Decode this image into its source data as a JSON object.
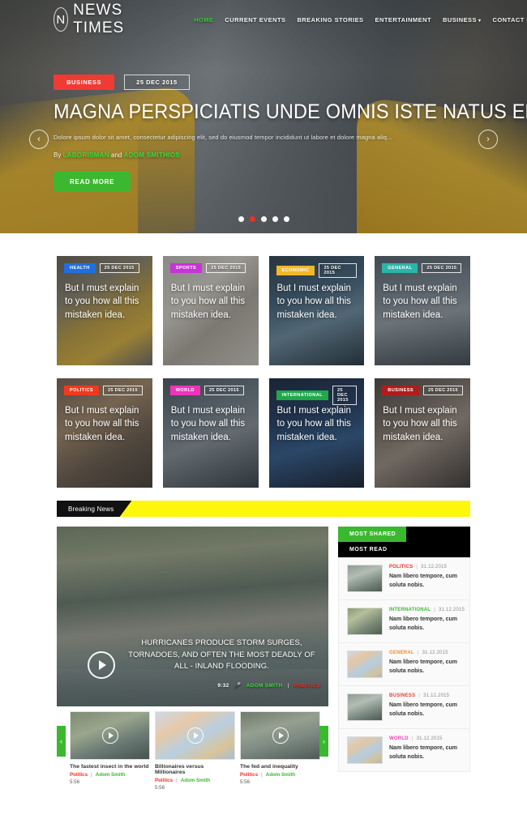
{
  "header": {
    "logo_initial": "N",
    "logo_text": "NEWS TIMES",
    "nav": [
      {
        "label": "HOME",
        "active": true
      },
      {
        "label": "CURRENT EVENTS",
        "active": false
      },
      {
        "label": "BREAKING STORIES",
        "active": false
      },
      {
        "label": "ENTERTAINMENT",
        "active": false
      },
      {
        "label": "BUSINESS",
        "active": false,
        "caret": "▾"
      },
      {
        "label": "CONTACT US",
        "active": false
      }
    ]
  },
  "hero": {
    "category": "BUSINESS",
    "category_color": "#ef3b33",
    "date": "25 DEC 2015",
    "title": "MAGNA PERSPICIATIS UNDE OMNIS ISTE NATUS ERRORS",
    "description": "Dolore ipsum dolor sit amet, consectetur adipiscing elit, sed do eiusmod tempor incididunt ut labore et dolore magna aliq...",
    "by_prefix": "By",
    "author1": "LABORISMAN",
    "by_and": "and",
    "author2": "ADOM SMITHIOS",
    "read_more": "READ MORE",
    "prev_arrow": "‹",
    "next_arrow": "›",
    "dots": 5,
    "active_dot": 1,
    "dot_active_color": "#ee3124"
  },
  "cards": [
    {
      "category": "HEALTH",
      "color": "#1f6fe0",
      "date": "25 DEC 2015",
      "title": "But I must explain to you how all this mistaken idea.",
      "photo": "ph-taxi"
    },
    {
      "category": "SPORTS",
      "color": "#c634d6",
      "date": "25 DEC 2015",
      "title": "But I must explain to you how all this mistaken idea.",
      "photo": "ph-paper"
    },
    {
      "category": "ECONOMIC",
      "color": "#f2b827",
      "date": "25 DEC 2015",
      "title": "But I must explain to you how all this mistaken idea.",
      "photo": "ph-plane"
    },
    {
      "category": "GENERAL",
      "color": "#2bb5a8",
      "date": "25 DEC 2015",
      "title": "But I must explain to you how all this mistaken idea.",
      "photo": "ph-tower"
    },
    {
      "category": "POLITICS",
      "color": "#f03a1e",
      "date": "25 DEC 2015",
      "title": "But I must explain to you how all this mistaken idea.",
      "photo": "ph-hands"
    },
    {
      "category": "WORLD",
      "color": "#ee33bb",
      "date": "25 DEC 2015",
      "title": "But I must explain to you how all this mistaken idea.",
      "photo": "ph-city"
    },
    {
      "category": "INTERNATIONAL",
      "color": "#1fa94a",
      "date": "25 DEC 2015",
      "title": "But I must explain to you how all this mistaken idea.",
      "photo": "ph-night"
    },
    {
      "category": "BUSINESS",
      "color": "#b01c1c",
      "date": "25 DEC 2015",
      "title": "But I must explain to you how all this mistaken idea.",
      "photo": "ph-wood"
    }
  ],
  "breaking": {
    "label": "Breaking News",
    "bar_color": "#fdf70c"
  },
  "video": {
    "caption": "HURRICANES PRODUCE STORM SURGES, TORNADOES, AND OFTEN THE MOST DEADLY OF ALL - INLAND FLOODING.",
    "duration": "9:32",
    "mic_icon": "🎤",
    "author": "ADOM SMITH",
    "separator": "|",
    "category": "POLITICS",
    "prev_arrow": "‹",
    "next_arrow": "›",
    "thumbs": [
      {
        "title": "The fastest insect in the world",
        "category": "Politics",
        "author": "Adom Smith",
        "duration": "5:56",
        "photo": "tp-tree"
      },
      {
        "title": "Billionaires versus Millionaires",
        "category": "Politics",
        "author": "Adom Smith",
        "duration": "5:56",
        "photo": "tp-money"
      },
      {
        "title": "The fed and inequality",
        "category": "Politics",
        "author": "Adom Smith",
        "duration": "5:56",
        "photo": "tp-rain"
      }
    ]
  },
  "sidebar": {
    "tabs": [
      {
        "label": "MOST SHARED",
        "active": true
      },
      {
        "label": "MOST READ",
        "active": false
      }
    ],
    "items": [
      {
        "category": "POLITICS",
        "date": "31.12.2015",
        "text": "Nam libero tempore, cum soluta nobis.",
        "photo": "st-car"
      },
      {
        "category": "INTERNATIONAL",
        "date": "31.12.2015",
        "text": "Nam libero tempore, cum soluta nobis.",
        "photo": "st-field"
      },
      {
        "category": "GENERAL",
        "date": "31.12.2015",
        "text": "Nam libero tempore, cum soluta nobis.",
        "photo": "st-money"
      },
      {
        "category": "BUSINESS",
        "date": "31.12.2015",
        "text": "Nam libero tempore, cum soluta nobis.",
        "photo": "st-car"
      },
      {
        "category": "WORLD",
        "date": "31.12.2015",
        "text": "Nam libero tempore, cum soluta nobis.",
        "photo": "st-money"
      }
    ]
  }
}
